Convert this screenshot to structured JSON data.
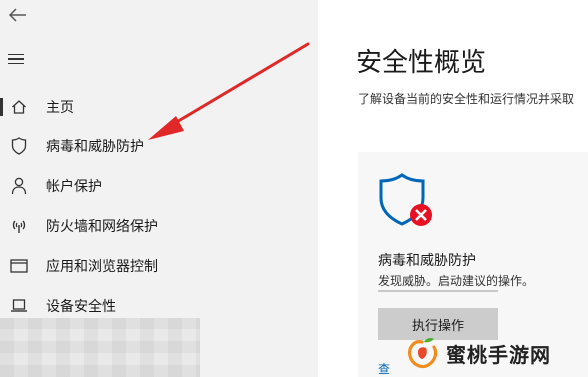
{
  "sidebar": {
    "items": [
      {
        "label": "主页",
        "icon": "home-icon"
      },
      {
        "label": "病毒和威胁防护",
        "icon": "shield-icon"
      },
      {
        "label": "帐户保护",
        "icon": "person-icon"
      },
      {
        "label": "防火墙和网络保护",
        "icon": "wireless-icon"
      },
      {
        "label": "应用和浏览器控制",
        "icon": "window-icon"
      },
      {
        "label": "设备安全性",
        "icon": "laptop-icon"
      }
    ],
    "active_index": 0
  },
  "main": {
    "title": "安全性概览",
    "subtitle": "了解设备当前的安全性和运行情况并采取"
  },
  "card": {
    "icon": "shield-error-icon",
    "title": "病毒和威胁防护",
    "description": "发现威胁。启动建议的操作。",
    "button_label": "执行操作",
    "link_text": "查"
  },
  "watermark": {
    "text": "蜜桃手游网"
  },
  "colors": {
    "sidebar_bg": "#f2f2f2",
    "accent_blue": "#0067b8",
    "error_red": "#e81123",
    "arrow_red": "#e02828",
    "button_bg": "#cccccc"
  }
}
